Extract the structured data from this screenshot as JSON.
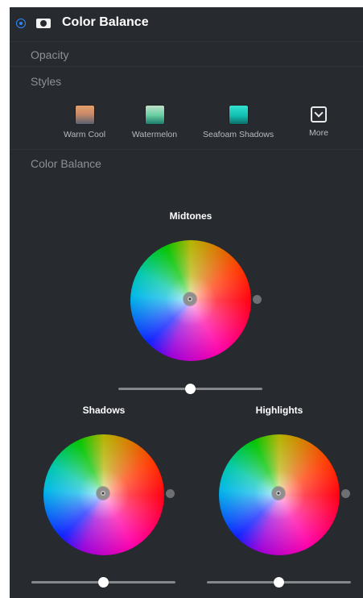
{
  "panel": {
    "title": "Color Balance",
    "opacity_label": "Opacity",
    "styles_label": "Styles",
    "section_label": "Color Balance"
  },
  "styles": [
    {
      "label": "Warm Cool",
      "swatch": "warm"
    },
    {
      "label": "Watermelon",
      "swatch": "watermelon"
    },
    {
      "label": "Seafoam Shadows",
      "swatch": "seafoam"
    },
    {
      "label": "More",
      "icon": "chevron-down-icon"
    }
  ],
  "wheels": {
    "midtones": {
      "label": "Midtones",
      "slider_value": 0.5
    },
    "shadows": {
      "label": "Shadows",
      "slider_value": 0.5
    },
    "highlights": {
      "label": "Highlights",
      "slider_value": 0.5
    }
  },
  "colors": {
    "panel_bg": "#272a2f",
    "accent": "#2f86ff",
    "label_muted": "#8d9096"
  }
}
